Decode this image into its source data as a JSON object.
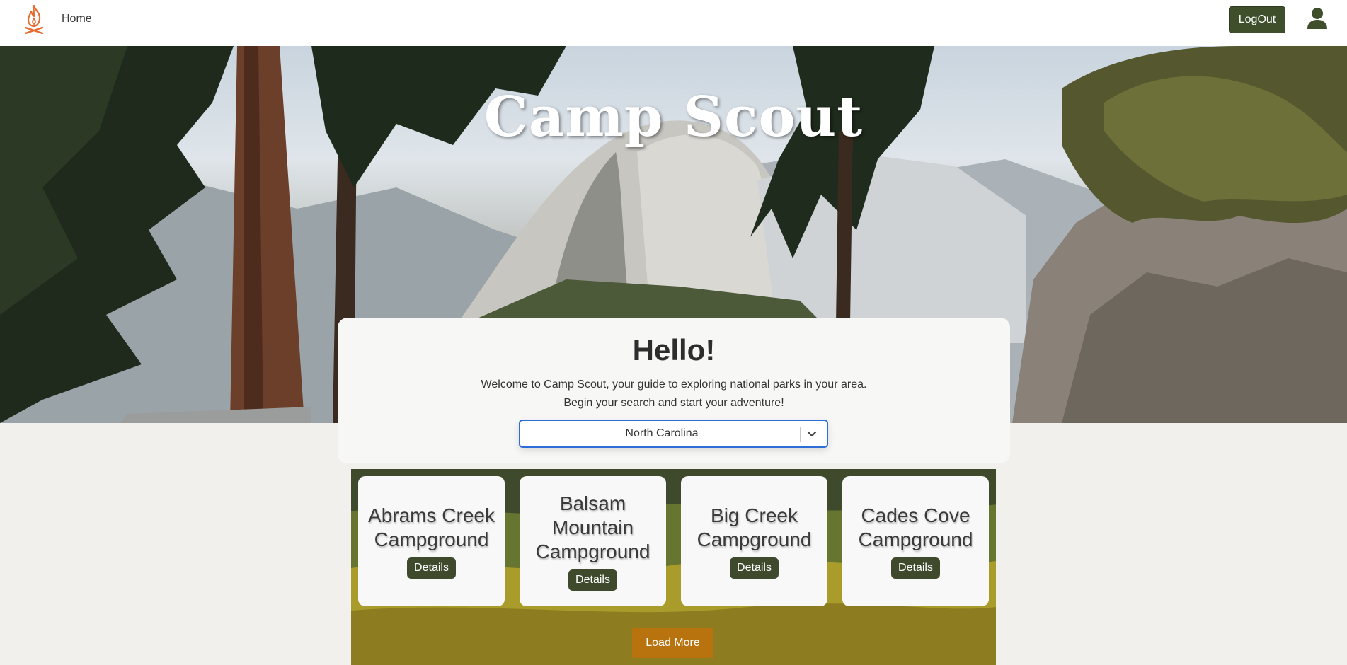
{
  "nav": {
    "logo_icon": "campfire-icon",
    "home_label": "Home",
    "logout_label": "LogOut",
    "user_icon": "user-icon",
    "accent_color": "#e86a2c"
  },
  "hero": {
    "title": "Camp Scout"
  },
  "welcome": {
    "heading": "Hello!",
    "line1": "Welcome to Camp Scout, your guide to exploring national parks in your area.",
    "line2": "Begin your search and start your adventure!",
    "state_select": {
      "selected": "North Carolina"
    }
  },
  "campgrounds": [
    {
      "name": "Abrams Creek Campground",
      "details_label": "Details"
    },
    {
      "name": "Balsam Mountain Campground",
      "details_label": "Details"
    },
    {
      "name": "Big Creek Campground",
      "details_label": "Details"
    },
    {
      "name": "Cades Cove Campground",
      "details_label": "Details"
    }
  ],
  "load_more_label": "Load More",
  "colors": {
    "primary_green": "#3f4f2c",
    "load_more": "#b8730f",
    "select_focus": "#2c6ed5"
  }
}
